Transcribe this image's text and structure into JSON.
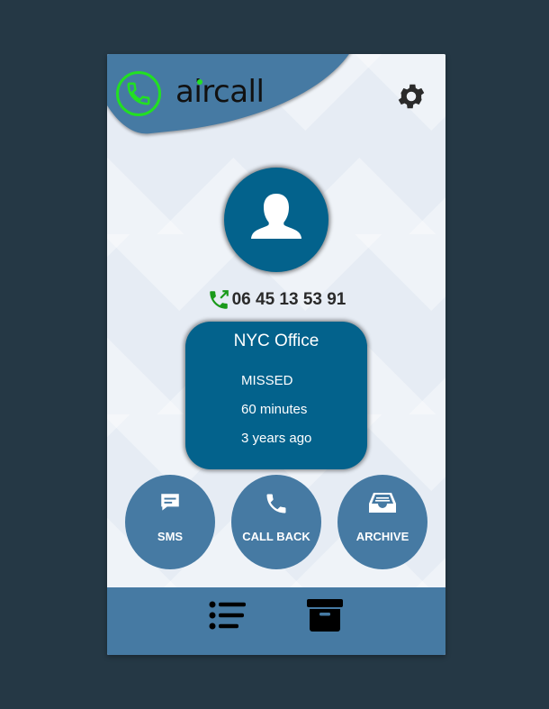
{
  "app": {
    "logo_text": "aircall"
  },
  "contact": {
    "phone_number": "06 45 13 53 91"
  },
  "call_info": {
    "title": "NYC Office",
    "status": "MISSED",
    "duration": "60 minutes",
    "when": "3 years ago"
  },
  "actions": [
    {
      "label": "SMS",
      "icon": "message-icon"
    },
    {
      "label": "CALL BACK",
      "icon": "phone-icon"
    },
    {
      "label": "ARCHIVE",
      "icon": "inbox-icon"
    }
  ],
  "footer": {
    "icons": [
      "list-icon",
      "archive-box-icon"
    ]
  },
  "colors": {
    "background": "#253845",
    "primary": "#467aa3",
    "card": "#03628c",
    "logo_green": "#22e022",
    "call_icon_green": "#1a9a1a"
  }
}
